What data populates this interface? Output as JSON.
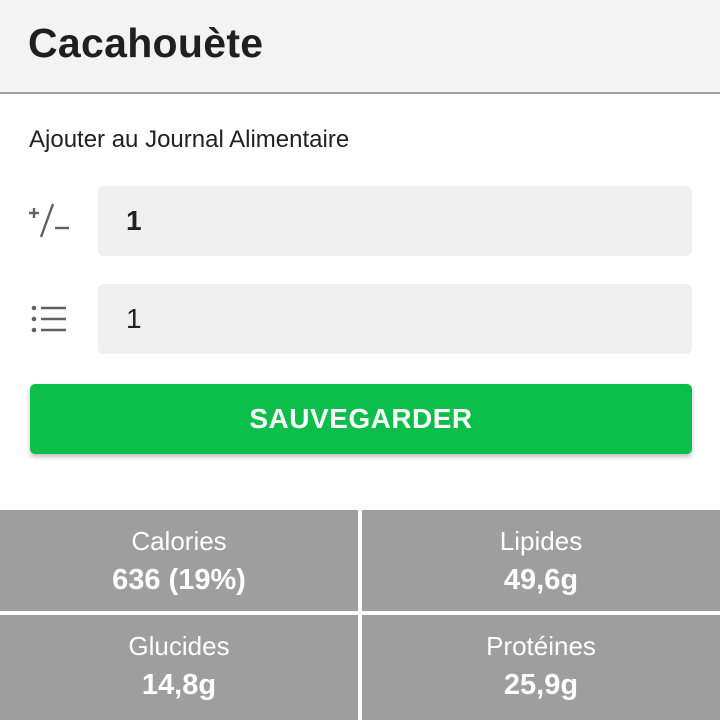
{
  "header": {
    "title": "Cacahouète"
  },
  "form": {
    "section_title": "Ajouter au Journal Alimentaire",
    "quantity": {
      "icon": "plus-minus-icon",
      "value": "1"
    },
    "servings": {
      "icon": "list-icon",
      "value": "1"
    },
    "save_label": "SAUVEGARDER"
  },
  "nutrition": [
    {
      "label": "Calories",
      "value": "636 (19%)"
    },
    {
      "label": "Lipides",
      "value": "49,6g"
    },
    {
      "label": "Glucides",
      "value": "14,8g"
    },
    {
      "label": "Protéines",
      "value": "25,9g"
    }
  ],
  "colors": {
    "accent": "#0cbf4a",
    "header_bg": "#f3f3f3",
    "tile_bg": "#9e9e9e",
    "input_bg": "#efefef"
  }
}
